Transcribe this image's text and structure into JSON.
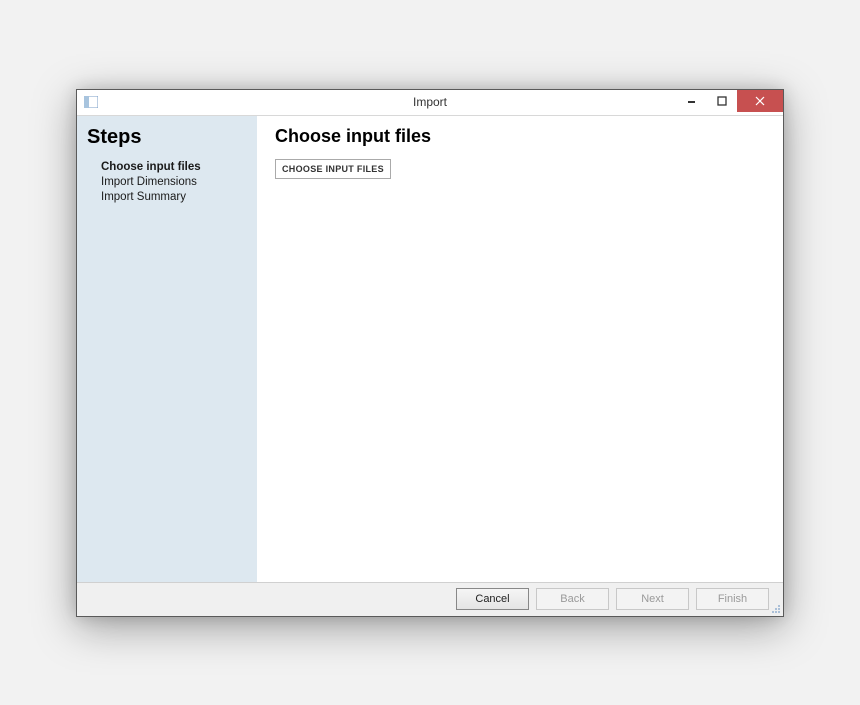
{
  "window": {
    "title": "Import"
  },
  "sidebar": {
    "header": "Steps",
    "steps": [
      {
        "label": "Choose input files",
        "active": true
      },
      {
        "label": "Import Dimensions",
        "active": false
      },
      {
        "label": "Import Summary",
        "active": false
      }
    ]
  },
  "main": {
    "header": "Choose input files",
    "choose_button_label": "CHOOSE INPUT FILES"
  },
  "footer": {
    "cancel": "Cancel",
    "back": "Back",
    "next": "Next",
    "finish": "Finish"
  }
}
